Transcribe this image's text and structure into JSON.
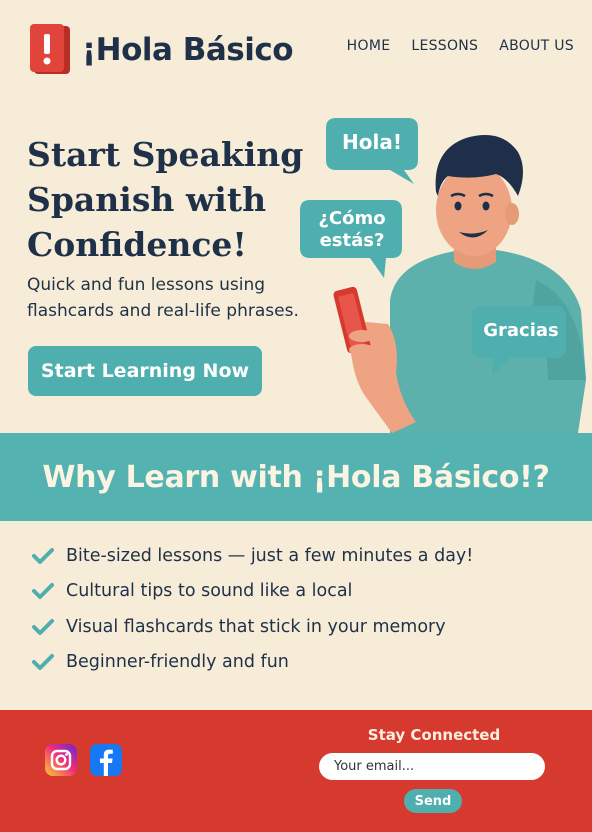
{
  "brand": {
    "name": "¡Hola Básico"
  },
  "nav": {
    "items": [
      {
        "label": "HOME"
      },
      {
        "label": "LESSONS"
      },
      {
        "label": "ABOUT US"
      }
    ]
  },
  "hero": {
    "title": "Start Speaking Spanish with Confidence!",
    "subtitle": "Quick and fun lessons using flashcards and real-life phrases.",
    "cta_label": "Start Learning Now",
    "bubbles": [
      "Hola!",
      "¿Cómo estás?",
      "Gracias"
    ]
  },
  "why": {
    "title": "Why Learn with ¡Hola Básico!?",
    "features": [
      "Bite-sized lessons — just a few minutes a day!",
      "Cultural tips to sound like a local",
      "Visual flashcards that stick in your memory",
      "Beginner-friendly and fun"
    ]
  },
  "footer": {
    "stay_connected": "Stay Connected",
    "email_placeholder": "Your email...",
    "send_label": "Send",
    "social": [
      "instagram-icon",
      "facebook-icon"
    ]
  },
  "colors": {
    "teal": "#54b2b1",
    "red": "#d63a2e",
    "navy": "#1f3148",
    "cream": "#f6ecd7"
  }
}
